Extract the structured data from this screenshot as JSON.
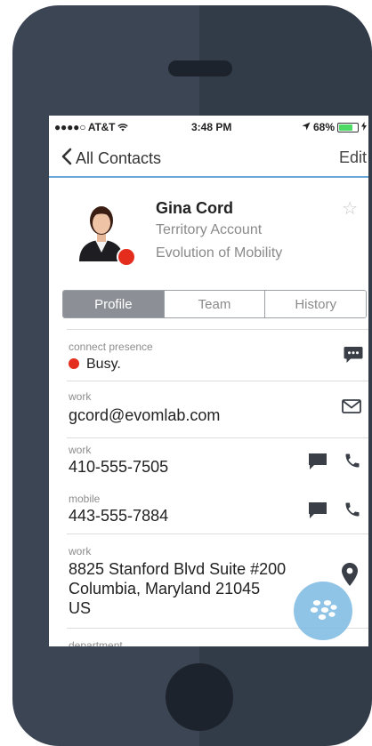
{
  "status_bar": {
    "carrier": "●●●●○ AT&T",
    "time": "3:48 PM",
    "battery": "68%",
    "battery_level": 0.68
  },
  "nav": {
    "back_label": "All Contacts",
    "edit_label": "Edit"
  },
  "contact": {
    "name": "Gina Cord",
    "title": "Territory Account",
    "company": "Evolution of Mobility"
  },
  "tabs": [
    {
      "label": "Profile",
      "active": true
    },
    {
      "label": "Team",
      "active": false
    },
    {
      "label": "History",
      "active": false
    }
  ],
  "details": {
    "presence_label": "connect presence",
    "presence_value": "Busy.",
    "email_label": "work",
    "email_value": "gcord@evomlab.com",
    "work_phone_label": "work",
    "work_phone_value": "410-555-7505",
    "mobile_label": "mobile",
    "mobile_value": "443-555-7884",
    "address_label": "work",
    "address_line1": "8825 Stanford Blvd Suite #200",
    "address_line2": "Columbia, Maryland 21045",
    "address_line3": "US",
    "department_label": "department"
  },
  "colors": {
    "presence_busy": "#e52d1e",
    "nav_accent": "#6aa6d6",
    "fab": "#7cbae2"
  }
}
